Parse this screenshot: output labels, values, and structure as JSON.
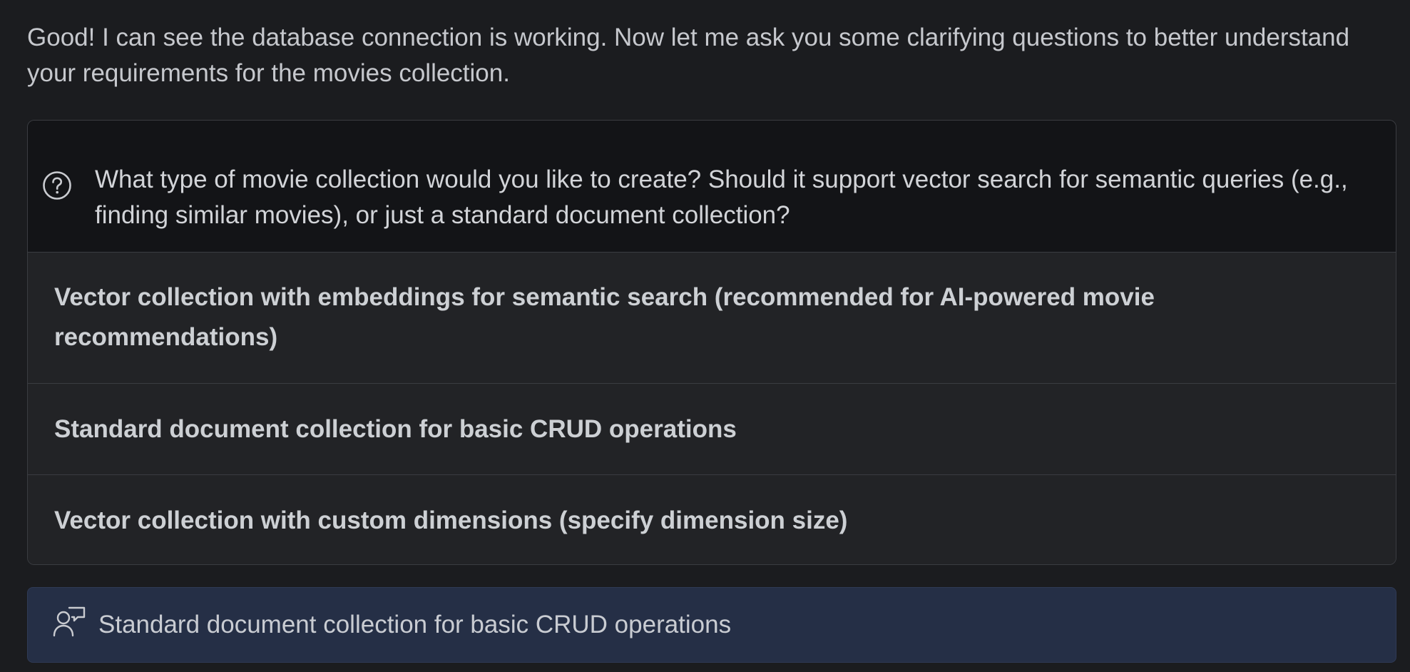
{
  "message": {
    "intro": "Good! I can see the database connection is working. Now let me ask you some clarifying questions to better understand your requirements for the movies collection."
  },
  "question": {
    "icon": "question-circle-icon",
    "text": "What type of movie collection would you like to create? Should it support vector search for semantic queries (e.g., finding similar movies), or just a standard document collection?",
    "options": [
      {
        "label": "Vector collection with embeddings for semantic search (recommended for AI-powered movie recommendations)"
      },
      {
        "label": "Standard document collection for basic CRUD operations"
      },
      {
        "label": "Vector collection with custom dimensions (specify dimension size)"
      }
    ]
  },
  "answer": {
    "icon": "user-response-icon",
    "text": "Standard document collection for basic CRUD operations"
  },
  "colors": {
    "background": "#1b1c1f",
    "question_header_bg": "#131417",
    "option_bg": "#222326",
    "answer_bg": "#252f46",
    "border": "#3a3c41"
  }
}
